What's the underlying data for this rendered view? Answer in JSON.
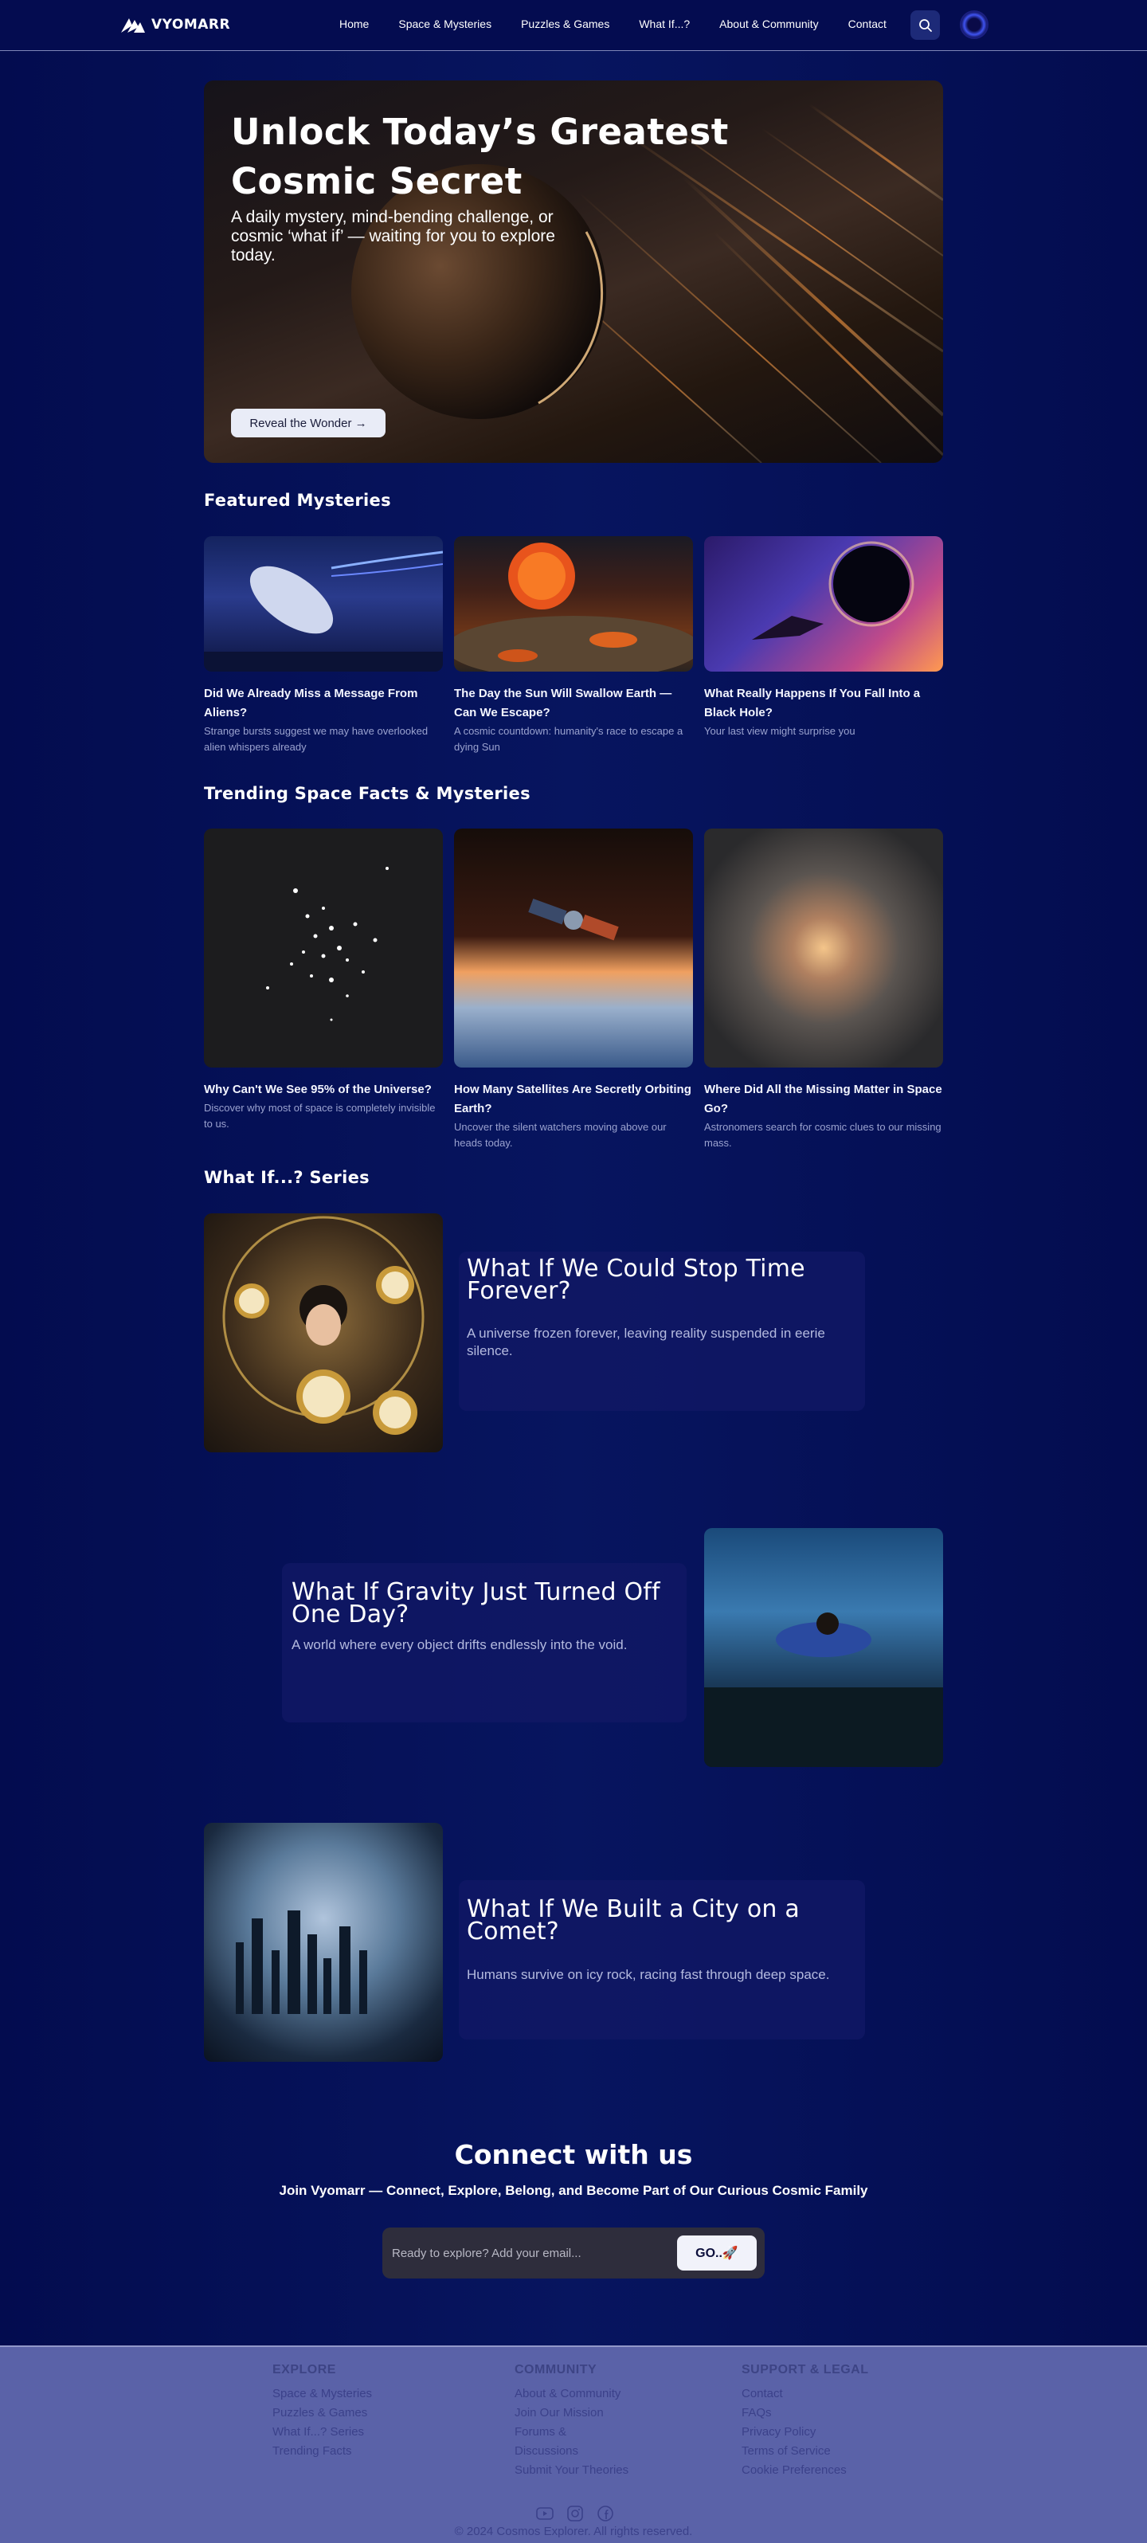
{
  "nav": {
    "brand": "VYOMARR",
    "links": [
      "Home",
      "Space & Mysteries",
      "Puzzles & Games",
      "What If...?",
      "About & Community",
      "Contact"
    ],
    "search_icon": "search-icon",
    "avatar_icon": "planet-avatar-icon"
  },
  "hero": {
    "title": "Unlock Today’s Greatest Cosmic Secret",
    "subtitle": "A daily mystery, mind-bending challenge, or cosmic ‘what if’ — waiting for you to explore today.",
    "button_label": "Reveal the Wonder →"
  },
  "featured": {
    "title": "Featured Mysteries",
    "cards": [
      {
        "title": "Did We Already Miss a Message From Aliens?",
        "desc": "Strange bursts suggest we may have overlooked alien whispers already"
      },
      {
        "title": "The Day the Sun Will Swallow Earth — Can We Escape?",
        "desc": "A cosmic countdown: humanity's race to escape a dying Sun"
      },
      {
        "title": "What Really Happens If You Fall Into a Black Hole?",
        "desc": "Your last view might surprise you"
      }
    ]
  },
  "trending": {
    "title": "Trending Space Facts & Mysteries",
    "cards": [
      {
        "title": "Why Can't We See 95% of the Universe?",
        "desc": "Discover why most of space is completely invisible to us."
      },
      {
        "title": "How Many Satellites Are Secretly Orbiting Earth?",
        "desc": "Uncover the silent watchers moving above our heads today."
      },
      {
        "title": "Where Did All the Missing Matter in Space Go?",
        "desc": "Astronomers search for cosmic clues to our missing mass."
      }
    ]
  },
  "whatif": {
    "title": "What If...? Series",
    "items": [
      {
        "title": "What If We Could Stop Time Forever?",
        "desc": "A universe frozen forever, leaving reality suspended in eerie silence."
      },
      {
        "title": "What If Gravity Just Turned Off One Day?",
        "desc": "A world where every object drifts endlessly into the void."
      },
      {
        "title": "What If We Built a City on a Comet?",
        "desc": "Humans survive on icy rock, racing fast through deep space."
      }
    ]
  },
  "connect": {
    "title": "Connect with us",
    "subtitle": "Join Vyomarr — Connect, Explore, Belong, and Become Part of Our Curious Cosmic Family",
    "placeholder": "Ready to explore? Add your email...",
    "button_label": "GO..🚀"
  },
  "footer": {
    "explore": {
      "heading": "EXPLORE",
      "links": [
        "Space & Mysteries",
        "Puzzles & Games",
        "What If...? Series",
        "Trending Facts"
      ]
    },
    "community": {
      "heading": "COMMUNITY",
      "links": [
        "About & Community",
        "Join Our Mission",
        "Forums &",
        "Discussions",
        "Submit Your Theories"
      ]
    },
    "support": {
      "heading": "SUPPORT & LEGAL",
      "links": [
        "Contact",
        "FAQs",
        "Privacy Policy",
        "Terms of Service",
        "Cookie Preferences"
      ]
    },
    "social_icons": [
      "youtube-icon",
      "instagram-icon",
      "facebook-icon"
    ],
    "copyright": "© 2024 Cosmos Explorer. All rights reserved."
  }
}
